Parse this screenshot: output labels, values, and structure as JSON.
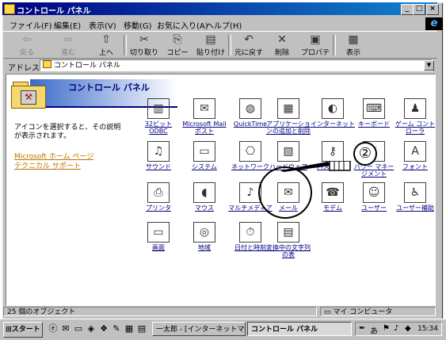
{
  "window": {
    "title": "コントロール パネル",
    "minimize": "_",
    "maximize": "□",
    "close": "×"
  },
  "menu": {
    "items": [
      "ファイル(F)",
      "編集(E)",
      "表示(V)",
      "移動(G)",
      "お気に入り(A)",
      "ヘルプ(H)"
    ]
  },
  "toolbar": {
    "back": "戻る",
    "forward": "進む",
    "up": "上へ",
    "cut": "切り取り",
    "copy": "コピー",
    "paste": "貼り付け",
    "undo": "元に戻す",
    "delete": "削除",
    "properties": "プロパティ",
    "view": "表示"
  },
  "address": {
    "label": "アドレス",
    "value": "コントロール パネル"
  },
  "panel": {
    "title": "コントロール パネル",
    "description": "アイコンを選択すると、その説明が表示されます。",
    "links": [
      "Microsoft ホーム ページ",
      "テクニカル サポート"
    ]
  },
  "icons": [
    {
      "label": "32ビット ODBC",
      "icon": "database-icon"
    },
    {
      "label": "Microsoft Mail ポスト",
      "icon": "mail-post-icon"
    },
    {
      "label": "QuickTime",
      "icon": "quicktime-icon"
    },
    {
      "label": "アプリケーションの追加と削除",
      "icon": "add-remove-programs-icon"
    },
    {
      "label": "インターネット",
      "icon": "internet-globe-icon"
    },
    {
      "label": "キーボード",
      "icon": "keyboard-icon"
    },
    {
      "label": "ゲーム コントローラ",
      "icon": "joystick-icon"
    },
    {
      "label": "サウンド",
      "icon": "speaker-icon"
    },
    {
      "label": "システム",
      "icon": "computer-icon"
    },
    {
      "label": "ネットワーク",
      "icon": "network-icon"
    },
    {
      "label": "ハードウェア",
      "icon": "hardware-icon"
    },
    {
      "label": "パスワード",
      "icon": "keys-icon"
    },
    {
      "label": "パワー マネージメント",
      "icon": "power-icon"
    },
    {
      "label": "フォント",
      "icon": "fonts-folder-icon"
    },
    {
      "label": "プリンタ",
      "icon": "printer-folder-icon"
    },
    {
      "label": "マウス",
      "icon": "mouse-icon"
    },
    {
      "label": "マルチメディア",
      "icon": "multimedia-icon"
    },
    {
      "label": "メール",
      "icon": "mail-icon"
    },
    {
      "label": "モデム",
      "icon": "modem-icon"
    },
    {
      "label": "ユーザー",
      "icon": "users-icon"
    },
    {
      "label": "ユーザー補助",
      "icon": "accessibility-icon"
    },
    {
      "label": "画面",
      "icon": "display-icon"
    },
    {
      "label": "地域",
      "icon": "globe-icon"
    },
    {
      "label": "日付と時刻",
      "icon": "calendar-clock-icon"
    },
    {
      "label": "変換中の文字列の表",
      "icon": "ime-table-icon"
    }
  ],
  "annotation": {
    "number": "②"
  },
  "status": {
    "count": "25 個のオブジェクト",
    "location": "マイ コンピュータ"
  },
  "taskbar": {
    "start": "スタート",
    "tasks": [
      "一太郎 - [インターネットマ",
      "コントロール パネル"
    ],
    "clock": "15:34"
  },
  "colors": {
    "title_bar": "#000080",
    "link": "#c07000",
    "icon_label": "#000080"
  }
}
